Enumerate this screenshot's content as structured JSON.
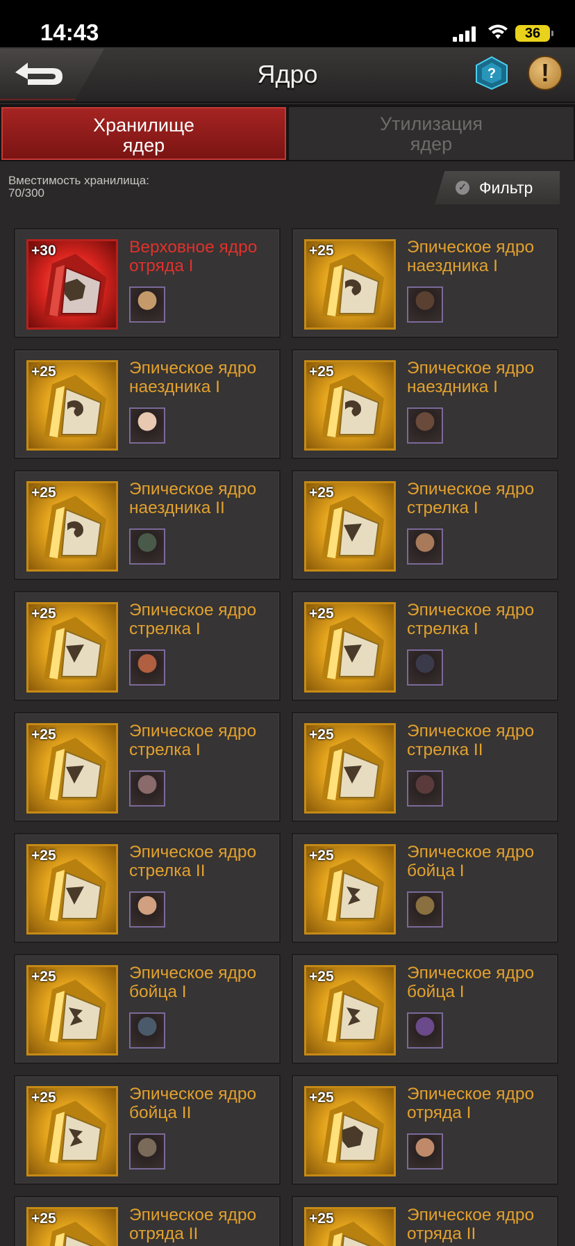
{
  "status_bar": {
    "time": "14:43",
    "battery": "36"
  },
  "header": {
    "title": "Ядро"
  },
  "tabs": [
    {
      "label": "Хранилище ядер",
      "active": true
    },
    {
      "label": "Утилизация ядер",
      "active": false
    }
  ],
  "storage": {
    "capacity_label": "Вместимость хранилища:",
    "capacity_value": "70/300"
  },
  "filter": {
    "label": "Фильтр"
  },
  "colors": {
    "accent_red": "#a52422",
    "gold": "#e3a12e",
    "red_text": "#e0312c"
  },
  "cores": [
    {
      "level": "+30",
      "name": "Верховное ядро отряда I",
      "rarity": "supreme",
      "emblem": "fist-icon",
      "hero": "hero-blonde-woman"
    },
    {
      "level": "+25",
      "name": "Эпическое ядро наездника I",
      "rarity": "epic",
      "emblem": "rider-icon",
      "hero": "hero-man-glasses"
    },
    {
      "level": "+25",
      "name": "Эпическое ядро наездника I",
      "rarity": "epic",
      "emblem": "rider-icon",
      "hero": "hero-nurse"
    },
    {
      "level": "+25",
      "name": "Эпическое ядро наездника I",
      "rarity": "epic",
      "emblem": "rider-icon",
      "hero": "hero-bearded-man"
    },
    {
      "level": "+25",
      "name": "Эпическое ядро наездника II",
      "rarity": "epic",
      "emblem": "rider-icon",
      "hero": "hero-soldier"
    },
    {
      "level": "+25",
      "name": "Эпическое ядро стрелка I",
      "rarity": "epic",
      "emblem": "shooter-icon",
      "hero": "hero-brunette"
    },
    {
      "level": "+25",
      "name": "Эпическое ядро стрелка I",
      "rarity": "epic",
      "emblem": "shooter-icon",
      "hero": "hero-redhead"
    },
    {
      "level": "+25",
      "name": "Эпическое ядро стрелка I",
      "rarity": "epic",
      "emblem": "shooter-icon",
      "hero": "hero-dark-man"
    },
    {
      "level": "+25",
      "name": "Эпическое ядро стрелка I",
      "rarity": "epic",
      "emblem": "shooter-icon",
      "hero": "hero-twins"
    },
    {
      "level": "+25",
      "name": "Эпическое ядро стрелка II",
      "rarity": "epic",
      "emblem": "shooter-icon",
      "hero": "hero-dark-woman"
    },
    {
      "level": "+25",
      "name": "Эпическое ядро стрелка II",
      "rarity": "epic",
      "emblem": "shooter-icon",
      "hero": "hero-glam-woman"
    },
    {
      "level": "+25",
      "name": "Эпическое ядро бойца I",
      "rarity": "epic",
      "emblem": "fighter-icon",
      "hero": "hero-masked"
    },
    {
      "level": "+25",
      "name": "Эпическое ядро бойца I",
      "rarity": "epic",
      "emblem": "fighter-icon",
      "hero": "hero-warrior-man"
    },
    {
      "level": "+25",
      "name": "Эпическое ядро бойца I",
      "rarity": "epic",
      "emblem": "fighter-icon",
      "hero": "hero-purple-hair"
    },
    {
      "level": "+25",
      "name": "Эпическое ядро бойца II",
      "rarity": "epic",
      "emblem": "fighter-icon",
      "hero": "hero-young-man"
    },
    {
      "level": "+25",
      "name": "Эпическое ядро отряда I",
      "rarity": "epic",
      "emblem": "fist-icon",
      "hero": "hero-cowgirl"
    },
    {
      "level": "+25",
      "name": "Эпическое ядро отряда II",
      "rarity": "epic",
      "emblem": "fist-icon",
      "hero": "hero-unknown"
    },
    {
      "level": "+25",
      "name": "Эпическое ядро отряда II",
      "rarity": "epic",
      "emblem": "fist-icon",
      "hero": "hero-unknown"
    }
  ]
}
